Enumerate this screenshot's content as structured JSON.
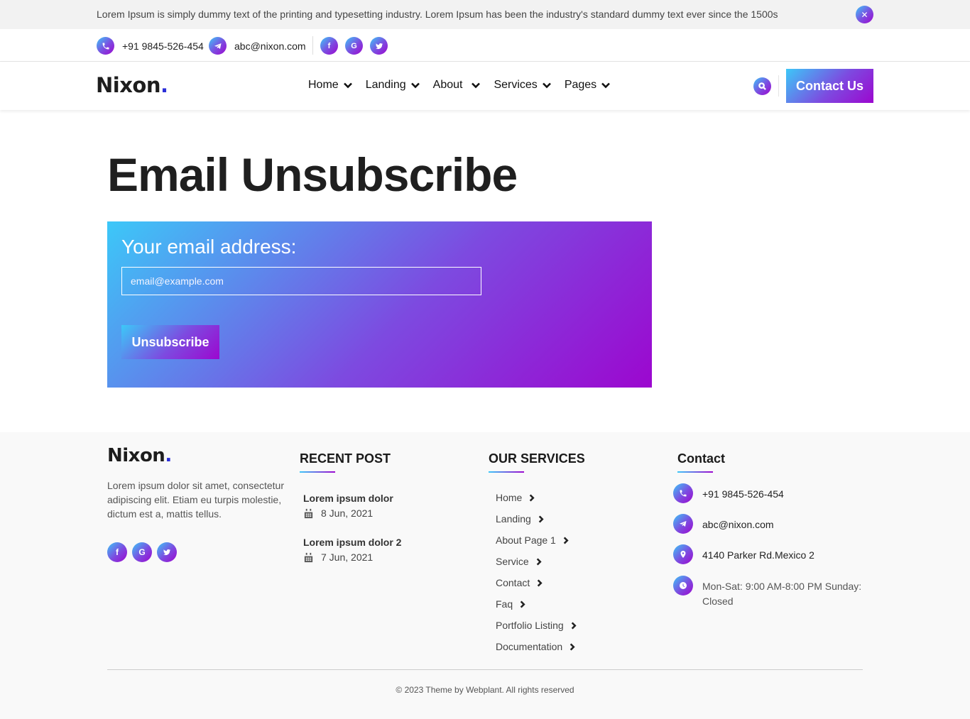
{
  "topbar": {
    "message": "Lorem Ipsum is simply dummy text of the printing and typesetting industry. Lorem Ipsum has been the industry's standard dummy text ever since the 1500s",
    "close_icon": "close-icon"
  },
  "contact_bar": {
    "phone": "+91 9845-526-454",
    "email": "abc@nixon.com",
    "social": [
      "facebook-icon",
      "google-icon",
      "twitter-icon"
    ]
  },
  "nav": {
    "logo": "Nixon",
    "logo_dot": ".",
    "items": [
      {
        "label": "Home"
      },
      {
        "label": "Landing"
      },
      {
        "label": "About"
      },
      {
        "label": "Services"
      },
      {
        "label": "Pages"
      }
    ],
    "contact_button": "Contact Us"
  },
  "main": {
    "title": "Email Unsubscribe",
    "form": {
      "label": "Your email address:",
      "placeholder": "email@example.com",
      "button": "Unsubscribe"
    }
  },
  "footer": {
    "logo": "Nixon",
    "logo_dot": ".",
    "about": "Lorem ipsum dolor sit amet, consectetur adipiscing elit. Etiam eu turpis molestie, dictum est a, mattis tellus.",
    "recent_post": {
      "heading": "RECENT POST",
      "posts": [
        {
          "title": "Lorem ipsum dolor",
          "date": "8 Jun, 2021"
        },
        {
          "title": "Lorem ipsum dolor 2",
          "date": "7 Jun, 2021"
        }
      ]
    },
    "services": {
      "heading": "OUR SERVICES",
      "items": [
        "Home",
        "Landing",
        "About Page 1",
        "Service",
        "Contact",
        "Faq",
        "Portfolio Listing",
        "Documentation"
      ]
    },
    "contact": {
      "heading": "Contact",
      "phone": "+91 9845-526-454",
      "email": "abc@nixon.com",
      "address": "4140 Parker Rd.Mexico 2",
      "hours": "Mon-Sat: 9:00 AM-8:00 PM Sunday: Closed"
    },
    "copyright": "© 2023 Theme by Webplant. All rights reserved"
  },
  "colors": {
    "gradient_start": "#3cc8f8",
    "gradient_mid": "#7d4ae0",
    "gradient_end": "#9c07cf",
    "logo_dot": "#2b2fd8"
  }
}
